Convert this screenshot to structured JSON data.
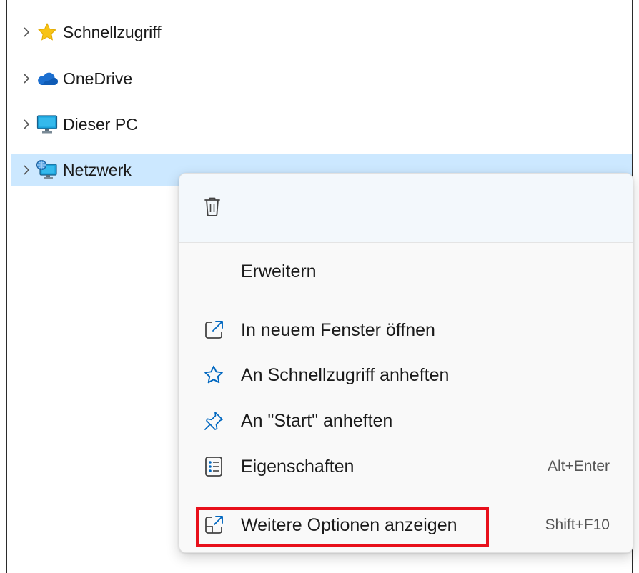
{
  "tree": {
    "items": [
      {
        "label": "Schnellzugriff",
        "icon": "star-icon"
      },
      {
        "label": "OneDrive",
        "icon": "cloud-icon"
      },
      {
        "label": "Dieser PC",
        "icon": "monitor-icon"
      },
      {
        "label": "Netzwerk",
        "icon": "network-icon",
        "selected": true
      }
    ]
  },
  "context_menu": {
    "top_actions": [
      {
        "icon": "trash-icon",
        "label": "Löschen"
      }
    ],
    "items": [
      {
        "label": "Erweitern",
        "icon": "",
        "shortcut": ""
      },
      {
        "label": "In neuem Fenster öffnen",
        "icon": "open-new-window-icon",
        "shortcut": ""
      },
      {
        "label": "An Schnellzugriff anheften",
        "icon": "star-outline-icon",
        "shortcut": ""
      },
      {
        "label": "An \"Start\" anheften",
        "icon": "pin-icon",
        "shortcut": ""
      },
      {
        "label": "Eigenschaften",
        "icon": "properties-icon",
        "shortcut": "Alt+Enter"
      },
      {
        "label": "Weitere Optionen anzeigen",
        "icon": "more-options-icon",
        "shortcut": "Shift+F10"
      }
    ]
  },
  "colors": {
    "selection": "#cce8ff",
    "accent": "#0067c0",
    "highlight_box": "#e8101b"
  }
}
